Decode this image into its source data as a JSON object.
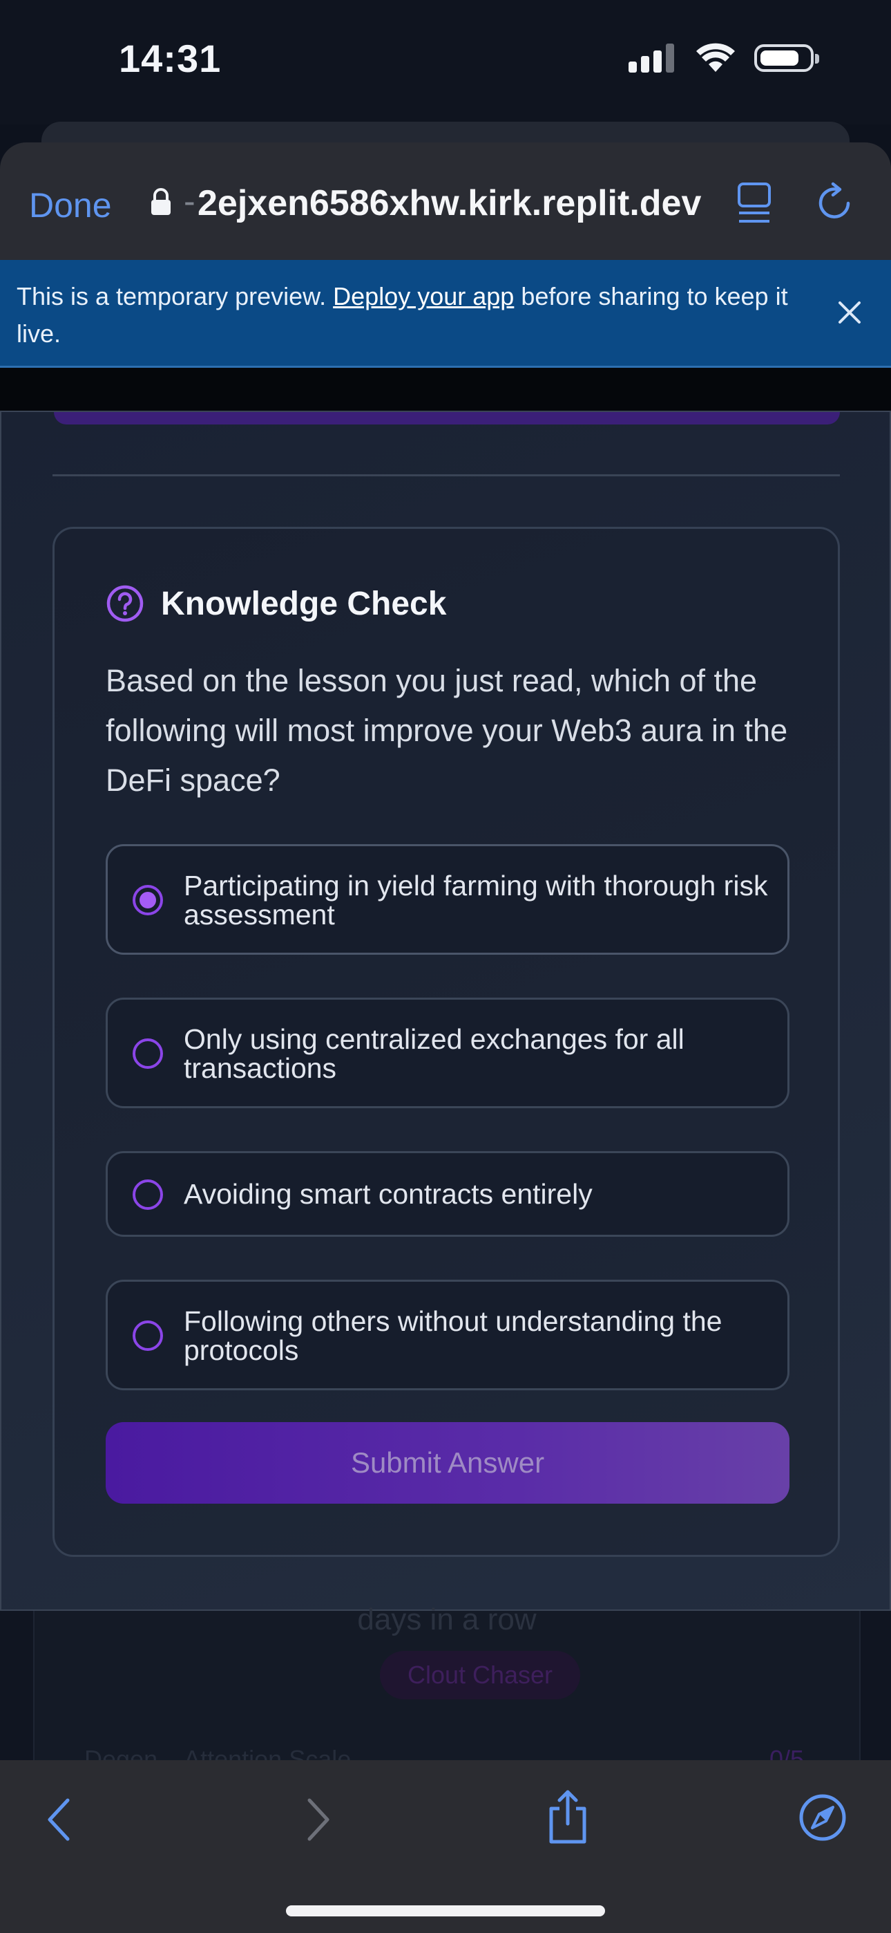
{
  "status_bar": {
    "time": "14:31"
  },
  "browser": {
    "done_label": "Done",
    "url_prefix": "-",
    "url": "2ejxen6586xhw.kirk.replit.dev"
  },
  "banner": {
    "text_before": "This is a temporary preview. ",
    "link_text": "Deploy your app",
    "text_after": " before sharing to keep it live."
  },
  "quiz": {
    "title": "Knowledge Check",
    "question": "Based on the lesson you just read, which of the following will most improve your Web3 aura in the DeFi space?",
    "options": [
      {
        "label": "Participating in yield farming with thorough risk assessment",
        "selected": true
      },
      {
        "label": "Only using centralized exchanges for all transactions",
        "selected": false
      },
      {
        "label": "Avoiding smart contracts entirely",
        "selected": false
      },
      {
        "label": "Following others without understanding the protocols",
        "selected": false
      }
    ],
    "submit_label": "Submit Answer"
  },
  "background_page": {
    "faded_text": "days in a row",
    "badge": "Clout Chaser",
    "row_label": "Degen... Attention Scale",
    "row_value": "0/5"
  },
  "colors": {
    "accent": "#8b45e8",
    "link_blue": "#5f95f0",
    "banner_bg": "#0b4a86"
  }
}
